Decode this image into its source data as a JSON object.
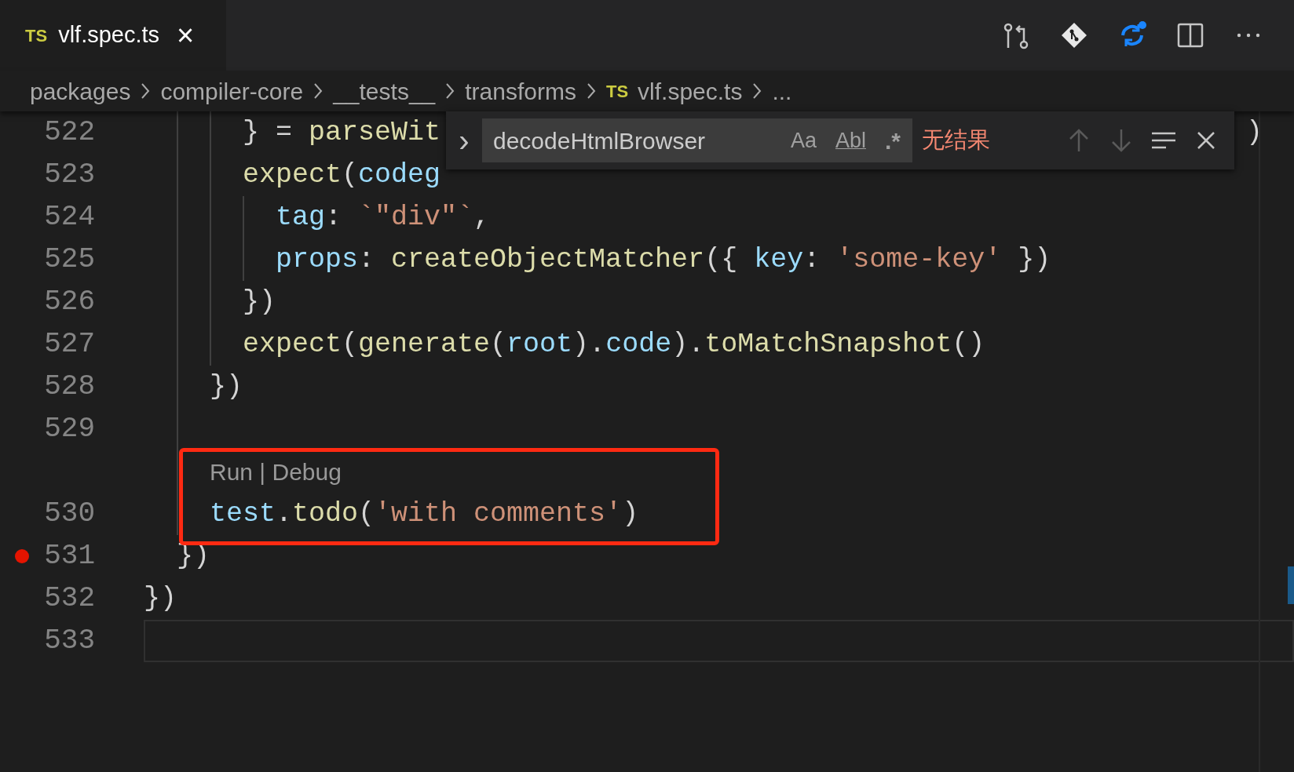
{
  "tabs": [
    {
      "badge": "TS",
      "label": "vlf.spec.ts",
      "close": "×",
      "selected": true
    }
  ],
  "breadcrumb": [
    {
      "label": "packages"
    },
    {
      "label": "compiler-core"
    },
    {
      "label": "__tests__"
    },
    {
      "label": "transforms"
    },
    {
      "badge": "TS",
      "label": "vlf.spec.ts"
    },
    {
      "label": "..."
    }
  ],
  "toolbar": [
    {
      "kind": "compare"
    },
    {
      "kind": "git"
    },
    {
      "kind": "diff"
    },
    {
      "kind": "split"
    },
    {
      "kind": "more"
    }
  ],
  "find": {
    "expand": "›",
    "value": "decodeHtmlBrowser",
    "toggles": [
      {
        "kind": "case",
        "label": "Aa",
        "on": false
      },
      {
        "kind": "word",
        "label": "Abl",
        "on": false
      },
      {
        "kind": "regex",
        "label": ".*",
        "on": false
      }
    ],
    "result": "无结果",
    "buttons": [
      {
        "kind": "up",
        "disabled": true
      },
      {
        "kind": "down",
        "disabled": true
      },
      {
        "kind": "selection",
        "disabled": false
      },
      {
        "kind": "close",
        "disabled": false
      }
    ]
  },
  "lines": [
    {
      "kind": "block",
      "children": [
        {
          "kind": "block",
          "children": [
            {
              "kind": "block",
              "children": [
                {
                  "kind": "code",
                  "number": "522",
                  "tokens": [
                    {
                      "t": "} = ",
                      "kind": "plain"
                    },
                    {
                      "t": "parseWit",
                      "kind": "fn"
                    }
                  ],
                  "tail": ")",
                  "breakpoint": false
                },
                {
                  "kind": "code",
                  "number": "523",
                  "tokens": [
                    {
                      "t": "expect",
                      "kind": "fn"
                    },
                    {
                      "t": "(",
                      "kind": "plain"
                    },
                    {
                      "t": "codeg",
                      "kind": "var"
                    }
                  ],
                  "breakpoint": false
                },
                {
                  "kind": "block",
                  "children": [
                    {
                      "kind": "code",
                      "number": "524",
                      "tokens": [
                        {
                          "t": "tag",
                          "kind": "var"
                        },
                        {
                          "t": ": ",
                          "kind": "plain"
                        },
                        {
                          "t": "`\"div\"`",
                          "kind": "str"
                        },
                        {
                          "t": ",",
                          "kind": "plain"
                        }
                      ],
                      "breakpoint": false
                    },
                    {
                      "kind": "code",
                      "number": "525",
                      "tokens": [
                        {
                          "t": "props",
                          "kind": "var"
                        },
                        {
                          "t": ": ",
                          "kind": "plain"
                        },
                        {
                          "t": "createObjectMatcher",
                          "kind": "fn"
                        },
                        {
                          "t": "({ ",
                          "kind": "plain"
                        },
                        {
                          "t": "key",
                          "kind": "var"
                        },
                        {
                          "t": ": ",
                          "kind": "plain"
                        },
                        {
                          "t": "'some-key'",
                          "kind": "str"
                        },
                        {
                          "t": " })",
                          "kind": "plain"
                        }
                      ],
                      "breakpoint": false
                    }
                  ]
                },
                {
                  "kind": "code",
                  "number": "526",
                  "tokens": [
                    {
                      "t": "})",
                      "kind": "plain"
                    }
                  ],
                  "breakpoint": false
                },
                {
                  "kind": "code",
                  "number": "527",
                  "tokens": [
                    {
                      "t": "expect",
                      "kind": "fn"
                    },
                    {
                      "t": "(",
                      "kind": "plain"
                    },
                    {
                      "t": "generate",
                      "kind": "fn"
                    },
                    {
                      "t": "(",
                      "kind": "plain"
                    },
                    {
                      "t": "root",
                      "kind": "var"
                    },
                    {
                      "t": ").",
                      "kind": "plain"
                    },
                    {
                      "t": "code",
                      "kind": "var"
                    },
                    {
                      "t": ").",
                      "kind": "plain"
                    },
                    {
                      "t": "toMatchSnapshot",
                      "kind": "fn"
                    },
                    {
                      "t": "()",
                      "kind": "plain"
                    }
                  ],
                  "breakpoint": false
                }
              ]
            },
            {
              "kind": "code",
              "number": "528",
              "tokens": [
                {
                  "t": "})",
                  "kind": "plain"
                }
              ],
              "breakpoint": false
            },
            {
              "kind": "code",
              "number": "529",
              "breakpoint": false
            },
            {
              "kind": "codelens",
              "text": "Run | Debug"
            },
            {
              "kind": "code",
              "number": "530",
              "tokens": [
                {
                  "t": "test",
                  "kind": "var"
                },
                {
                  "t": ".",
                  "kind": "plain"
                },
                {
                  "t": "todo",
                  "kind": "fn"
                },
                {
                  "t": "(",
                  "kind": "plain"
                },
                {
                  "t": "'with comments'",
                  "kind": "str"
                },
                {
                  "t": ")",
                  "kind": "plain"
                }
              ],
              "breakpoint": false
            }
          ]
        },
        {
          "kind": "code",
          "number": "531",
          "tokens": [
            {
              "t": "})",
              "kind": "plain"
            }
          ],
          "breakpoint": true
        }
      ]
    },
    {
      "kind": "code",
      "number": "532",
      "tokens": [
        {
          "t": "})",
          "kind": "plain"
        }
      ],
      "breakpoint": false
    },
    {
      "kind": "code",
      "number": "533",
      "breakpoint": false,
      "current": true
    }
  ],
  "callout": {
    "kind": "rectangle"
  }
}
